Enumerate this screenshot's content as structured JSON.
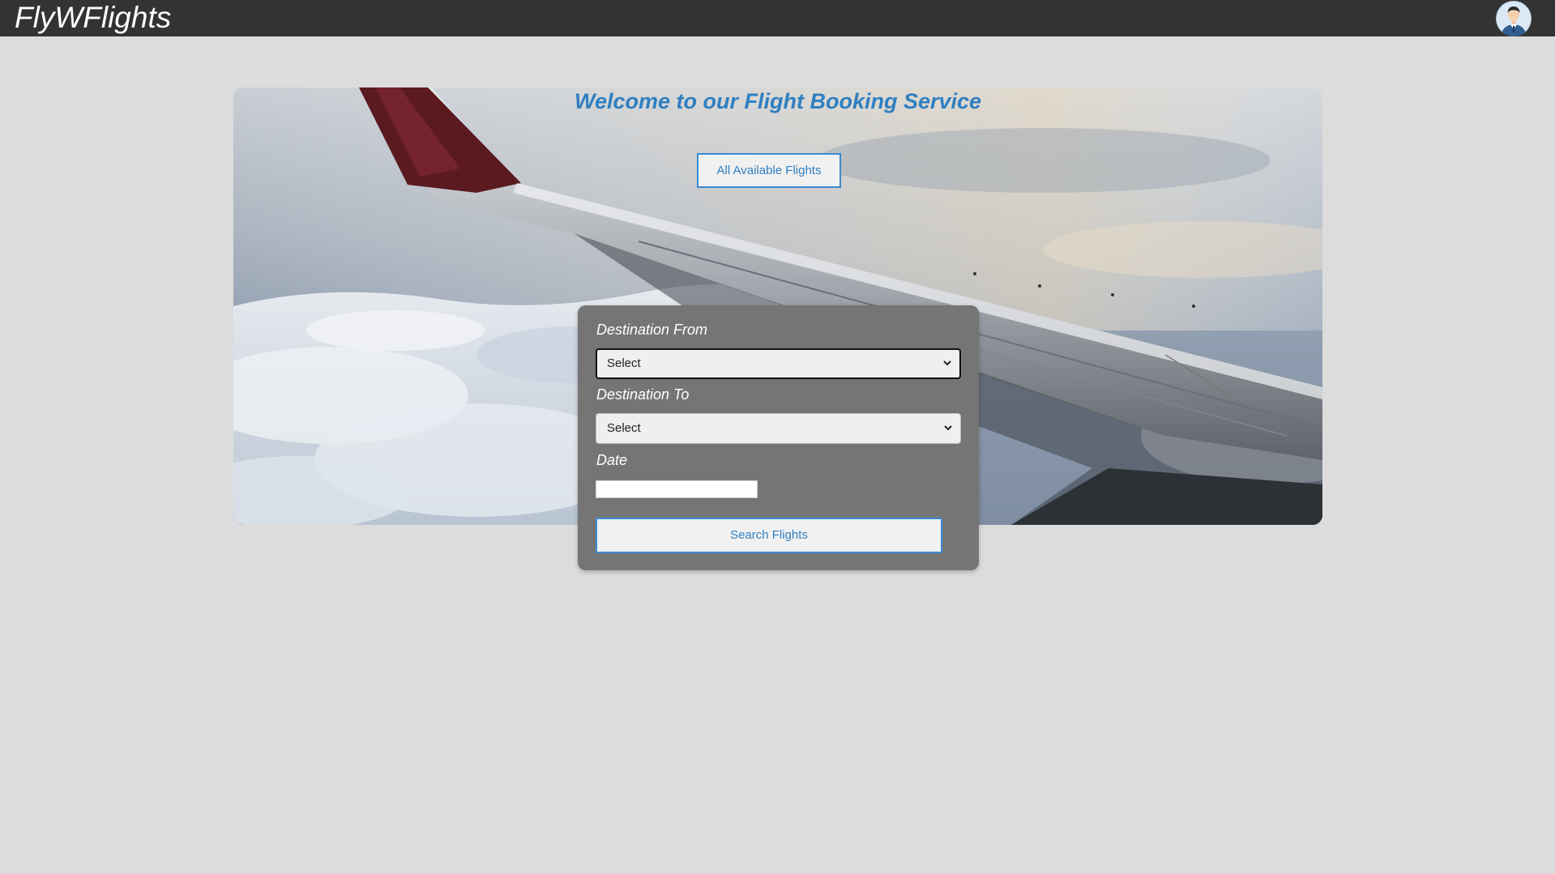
{
  "navbar": {
    "brand": "FlyWFlights",
    "avatar_icon": "user-avatar-icon"
  },
  "hero": {
    "welcome": "Welcome to our Flight Booking Service",
    "all_flights_label": "All Available Flights"
  },
  "search": {
    "from_label": "Destination From",
    "from_value": "Select",
    "to_label": "Destination To",
    "to_value": "Select",
    "date_label": "Date",
    "date_value": "",
    "search_label": "Search Flights"
  },
  "colors": {
    "navbar": "#333333",
    "page_bg": "#dcdcdc",
    "accent": "#2f7fc1",
    "panel": "#757575"
  }
}
